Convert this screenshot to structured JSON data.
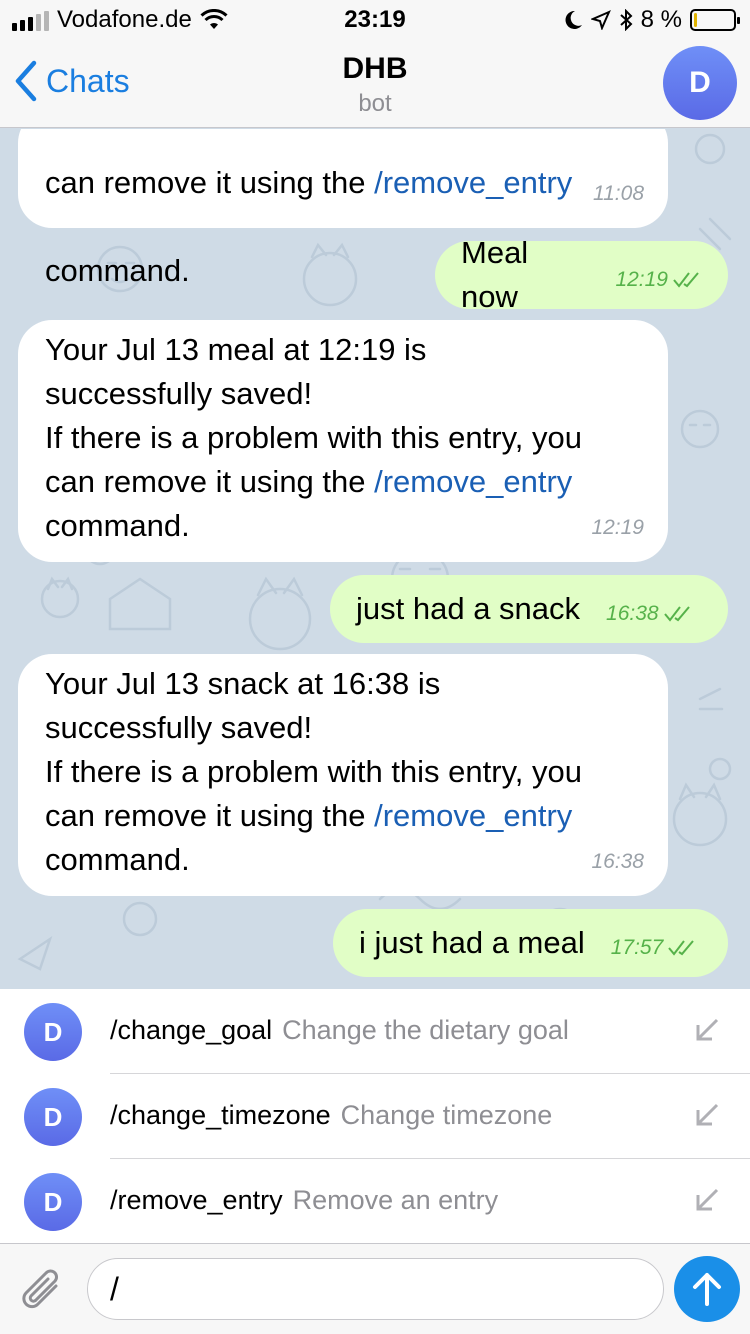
{
  "status_bar": {
    "carrier": "Vodafone.de",
    "time": "23:19",
    "battery": "8 %",
    "battery_level": 0.08
  },
  "header": {
    "back_label": "Chats",
    "title": "DHB",
    "subtitle": "bot",
    "avatar_letter": "D"
  },
  "messages": [
    {
      "direction": "in",
      "line1": "can remove it using the ",
      "link": "/remove_entry",
      "line2": "command.",
      "time": "11:08"
    },
    {
      "direction": "out",
      "text": "Meal now",
      "time": "12:19"
    },
    {
      "direction": "in",
      "body": "Your Jul 13 meal at 12:19 is\nsuccessfully saved!\nIf there is a problem with this entry, you\ncan remove it using the ",
      "link": "/remove_entry",
      "tail": "command.",
      "time": "12:19"
    },
    {
      "direction": "out",
      "text": "just had a snack",
      "time": "16:38"
    },
    {
      "direction": "in",
      "body": "Your Jul 13 snack at 16:38 is\nsuccessfully saved!\nIf there is a problem with this entry, you\ncan remove it using the ",
      "link": "/remove_entry",
      "tail": "command.",
      "time": "16:38"
    },
    {
      "direction": "out",
      "text": "i just had a meal",
      "time": "17:57"
    }
  ],
  "commands": [
    {
      "avatar_letter": "D",
      "name": "/change_goal",
      "description": "Change the dietary goal"
    },
    {
      "avatar_letter": "D",
      "name": "/change_timezone",
      "description": "Change timezone"
    },
    {
      "avatar_letter": "D",
      "name": "/remove_entry",
      "description": "Remove an entry"
    }
  ],
  "composer": {
    "value": "/"
  },
  "colors": {
    "accent": "#1a7ee0",
    "outgoing_bubble": "#e1fec6",
    "incoming_bubble": "#ffffff",
    "chat_background": "#cfdbe6",
    "read_ticks": "#56b24a"
  }
}
